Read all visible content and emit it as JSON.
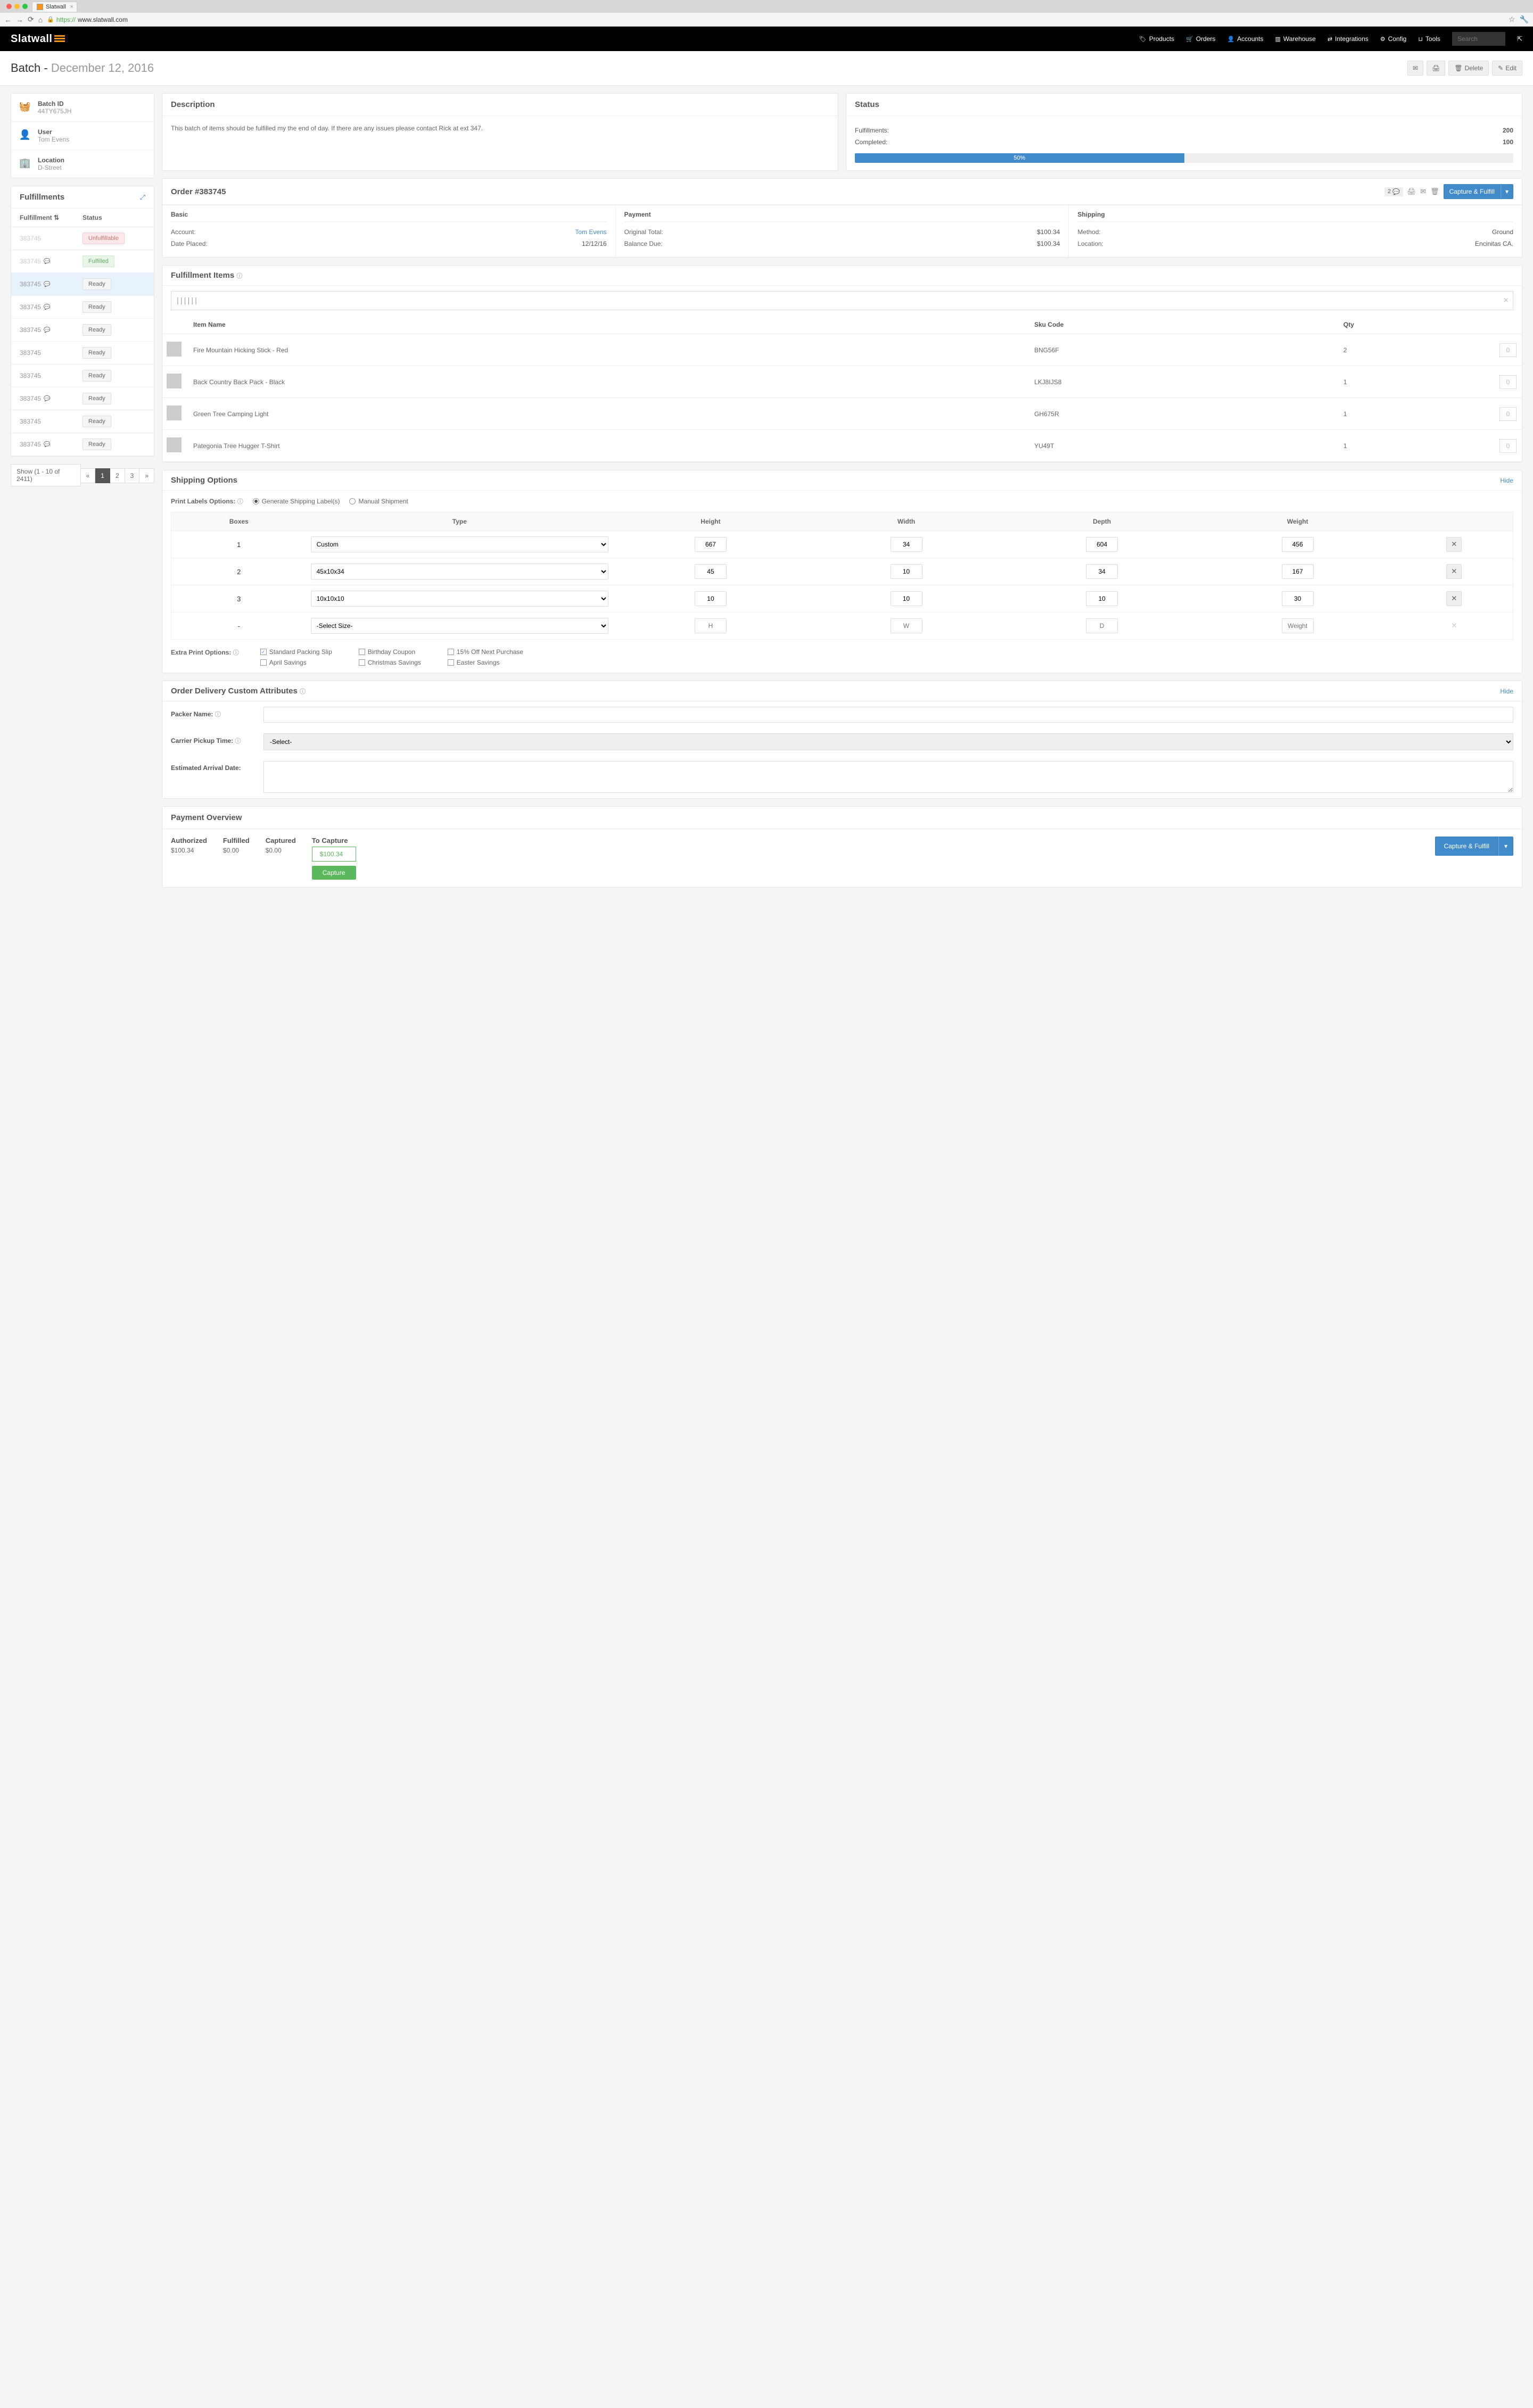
{
  "browser": {
    "tab_title": "Slatwall",
    "url_prefix": "https://",
    "url": "www.slatwall.com"
  },
  "brand": "Slatwall",
  "nav": {
    "products": "Products",
    "orders": "Orders",
    "accounts": "Accounts",
    "warehouse": "Warehouse",
    "integrations": "Integrations",
    "config": "Config",
    "tools": "Tools",
    "search_placeholder": "Search"
  },
  "header": {
    "title_prefix": "Batch -",
    "title_date": "December 12, 2016",
    "delete": "Delete",
    "edit": "Edit"
  },
  "batch_info": {
    "id_label": "Batch ID",
    "id_value": "44TY675JH",
    "user_label": "User",
    "user_value": "Tom Evens",
    "location_label": "Location",
    "location_value": "D-Street"
  },
  "description": {
    "title": "Description",
    "text": "This batch of items should be fulfilled my the end of day. If there are any issues please contact Rick at ext 347."
  },
  "status": {
    "title": "Status",
    "fulfillments_label": "Fulfillments:",
    "fulfillments_value": "200",
    "completed_label": "Completed:",
    "completed_value": "100",
    "progress": "50%"
  },
  "fulfillments": {
    "title": "Fulfillments",
    "col_fulfillment": "Fulfillment",
    "col_status": "Status",
    "rows": [
      {
        "id": "383745",
        "status": "Unfulfillable",
        "style": "red",
        "comment": false,
        "disabled": true
      },
      {
        "id": "383745",
        "status": "Fulfilled",
        "style": "green",
        "comment": true,
        "disabled": true
      },
      {
        "id": "383745",
        "status": "Ready",
        "style": "",
        "comment": true,
        "active": true
      },
      {
        "id": "383745",
        "status": "Ready",
        "style": "",
        "comment": true
      },
      {
        "id": "383745",
        "status": "Ready",
        "style": "",
        "comment": true
      },
      {
        "id": "383745",
        "status": "Ready",
        "style": "",
        "comment": false
      },
      {
        "id": "383745",
        "status": "Ready",
        "style": "",
        "comment": false
      },
      {
        "id": "383745",
        "status": "Ready",
        "style": "",
        "comment": true
      },
      {
        "id": "383745",
        "status": "Ready",
        "style": "",
        "comment": false
      },
      {
        "id": "383745",
        "status": "Ready",
        "style": "",
        "comment": true
      }
    ],
    "pagination_text": "Show (1 - 10 of 2411)",
    "pages": [
      "«",
      "1",
      "2",
      "3",
      "»"
    ]
  },
  "order": {
    "title": "Order #383745",
    "comment_count": "2",
    "capture_fulfill": "Capture & Fulfill",
    "basic_title": "Basic",
    "payment_title": "Payment",
    "shipping_title": "Shipping",
    "account_label": "Account:",
    "account_value": "Tom Evens",
    "date_label": "Date Placed:",
    "date_value": "12/12/16",
    "original_label": "Original Total:",
    "original_value": "$100.34",
    "balance_label": "Balance Due:",
    "balance_value": "$100.34",
    "method_label": "Method:",
    "method_value": "Ground",
    "location_label": "Location:",
    "location_value": "Encinitas CA."
  },
  "items": {
    "title": "Fulfillment Items",
    "col_name": "Item Name",
    "col_sku": "Sku Code",
    "col_qty": "Qty",
    "rows": [
      {
        "name": "Fire Mountain Hicking Stick - Red",
        "sku": "BNG56F",
        "qty": "2",
        "input": "0"
      },
      {
        "name": "Back Country Back Pack - Black",
        "sku": "LKJ8IJS8",
        "qty": "1",
        "input": "0"
      },
      {
        "name": "Green Tree Camping Light",
        "sku": "GH675R",
        "qty": "1",
        "input": "0"
      },
      {
        "name": "Pategonia Tree Hugger T-Shirt",
        "sku": "YU49T",
        "qty": "1",
        "input": "0"
      }
    ]
  },
  "shipping": {
    "title": "Shipping Options",
    "hide": "Hide",
    "print_label": "Print Labels Options:",
    "opt_generate": "Generate Shipping Label(s)",
    "opt_manual": "Manual Shipment",
    "col_boxes": "Boxes",
    "col_type": "Type",
    "col_height": "Height",
    "col_width": "Width",
    "col_depth": "Depth",
    "col_weight": "Weight",
    "boxes": [
      {
        "n": "1",
        "type": "Custom",
        "h": "667",
        "w": "34",
        "d": "604",
        "wt": "456"
      },
      {
        "n": "2",
        "type": "45x10x34",
        "h": "45",
        "w": "10",
        "d": "34",
        "wt": "167"
      },
      {
        "n": "3",
        "type": "10x10x10",
        "h": "10",
        "w": "10",
        "d": "10",
        "wt": "30"
      },
      {
        "n": "-",
        "type": "-Select Size-",
        "h": "",
        "w": "",
        "d": "",
        "wt": "",
        "placeholder": true,
        "ph_h": "H",
        "ph_w": "W",
        "ph_d": "D",
        "ph_wt": "Weight"
      }
    ],
    "extra_label": "Extra Print Options:",
    "extra": [
      {
        "label": "Standard Packing Slip",
        "checked": true
      },
      {
        "label": "April Savings",
        "checked": false
      },
      {
        "label": "Birthday Coupon",
        "checked": false
      },
      {
        "label": "Christmas Savings",
        "checked": false
      },
      {
        "label": "15% Off Next Purchase",
        "checked": false
      },
      {
        "label": "Easter Savings",
        "checked": false
      }
    ]
  },
  "custom_attrs": {
    "title": "Order Delivery Custom Attributes",
    "hide": "Hide",
    "packer_label": "Packer Name:",
    "carrier_label": "Carrier Pickup Time:",
    "carrier_value": "-Select-",
    "arrival_label": "Estimated Arrival Date:"
  },
  "payment": {
    "title": "Payment Overview",
    "authorized_label": "Authorized",
    "authorized_value": "$100.34",
    "fulfilled_label": "Fulfilled",
    "fulfilled_value": "$0.00",
    "captured_label": "Captured",
    "captured_value": "$0.00",
    "to_capture_label": "To Capture",
    "to_capture_value": "$100.34",
    "capture_btn": "Capture",
    "capture_fulfill": "Capture & Fulfill"
  }
}
